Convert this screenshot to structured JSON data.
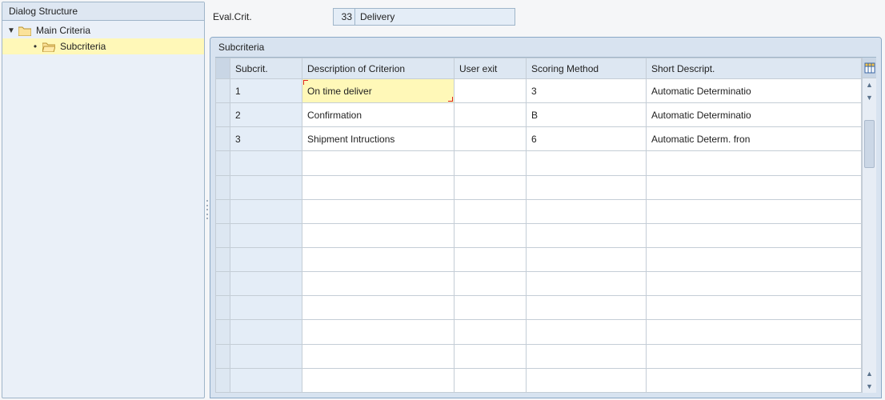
{
  "left_panel": {
    "title": "Dialog Structure",
    "tree": [
      {
        "label": "Main Criteria",
        "selected": false
      },
      {
        "label": "Subcriteria",
        "selected": true
      }
    ]
  },
  "form": {
    "label": "Eval.Crit.",
    "code": "33",
    "desc": "Delivery"
  },
  "group": {
    "title": "Subcriteria",
    "columns": {
      "subcrit": "Subcrit.",
      "desc": "Description of Criterion",
      "userexit": "User exit",
      "scoring": "Scoring Method",
      "short": "Short Descript."
    },
    "rows": [
      {
        "subcrit": "1",
        "desc": "On time deliver",
        "userexit": "",
        "scoring": "3",
        "short": "Automatic Determinatio",
        "edited": true
      },
      {
        "subcrit": "2",
        "desc": "Confirmation",
        "userexit": "",
        "scoring": "B",
        "short": "Automatic Determinatio"
      },
      {
        "subcrit": "3",
        "desc": "Shipment Intructions",
        "userexit": "",
        "scoring": "6",
        "short": "Automatic Determ. fron"
      }
    ],
    "empty_row_count": 10
  }
}
